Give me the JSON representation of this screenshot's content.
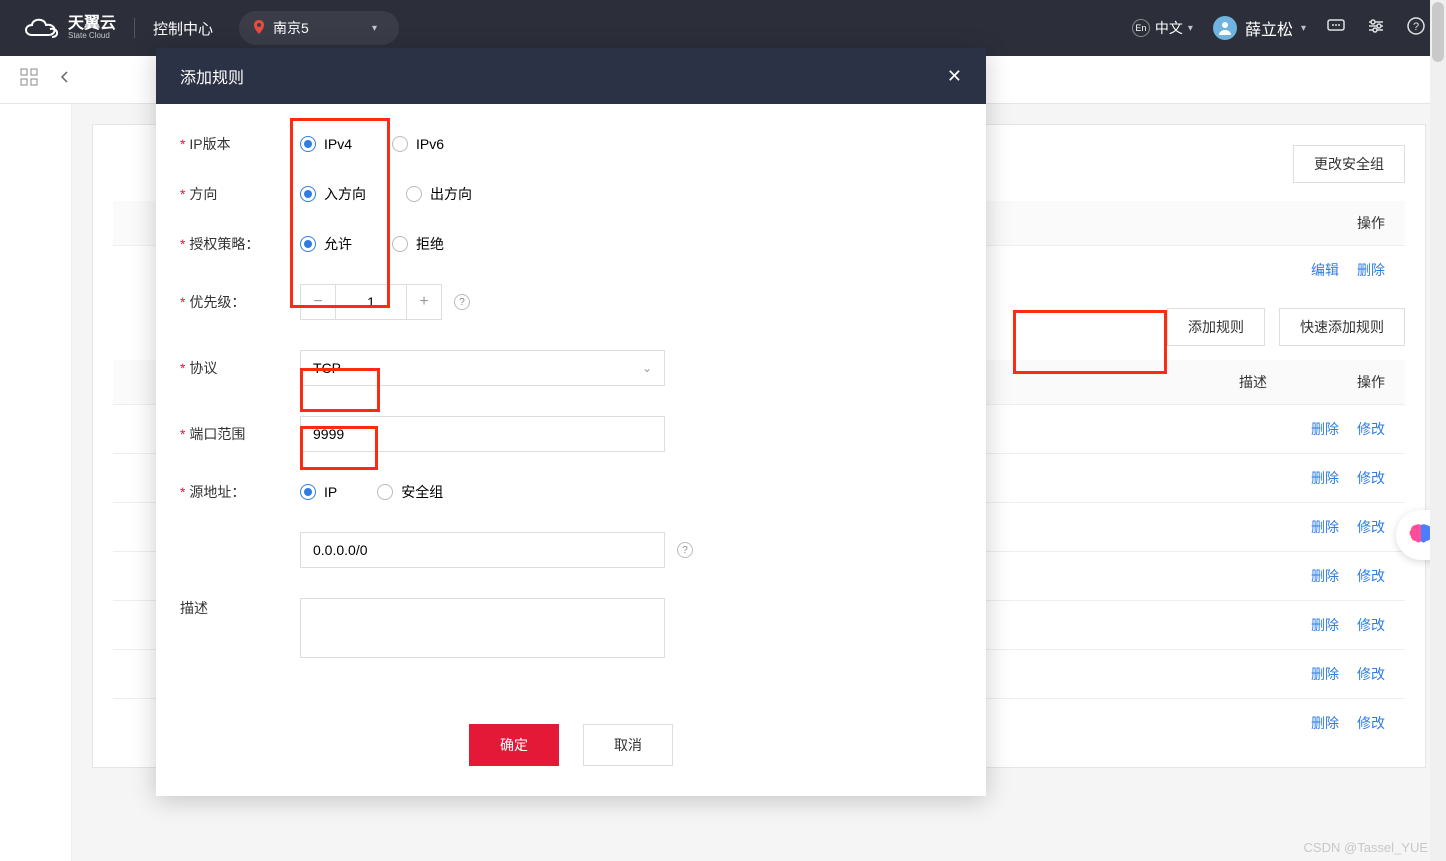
{
  "header": {
    "brand_cn": "天翼云",
    "brand_en": "State Cloud",
    "control_center": "控制中心",
    "region": "南京5",
    "lang_badge": "En",
    "lang_label": "中文",
    "username": "薛立松"
  },
  "bg": {
    "change_group_btn": "更改安全组",
    "ops_header": "操作",
    "edit": "编辑",
    "delete": "删除",
    "add_rule_btn": "添加规则",
    "quick_add_btn": "快速添加规则",
    "desc_header": "描述",
    "row_delete": "删除",
    "row_modify": "修改"
  },
  "modal": {
    "title": "添加规则",
    "fields": {
      "ip_version": {
        "label": "IP版本",
        "opt1": "IPv4",
        "opt2": "IPv6"
      },
      "direction": {
        "label": "方向",
        "opt1": "入方向",
        "opt2": "出方向"
      },
      "policy": {
        "label": "授权策略：",
        "opt1": "允许",
        "opt2": "拒绝"
      },
      "priority": {
        "label": "优先级：",
        "value": "1"
      },
      "protocol": {
        "label": "协议",
        "value": "TCP"
      },
      "port": {
        "label": "端口范围",
        "value": "9999"
      },
      "source": {
        "label": "源地址：",
        "opt1": "IP",
        "opt2": "安全组"
      },
      "cidr": {
        "value": "0.0.0.0/0"
      },
      "desc": {
        "label": "描述"
      }
    },
    "confirm": "确定",
    "cancel": "取消"
  },
  "watermark": "CSDN @Tassel_YUE"
}
